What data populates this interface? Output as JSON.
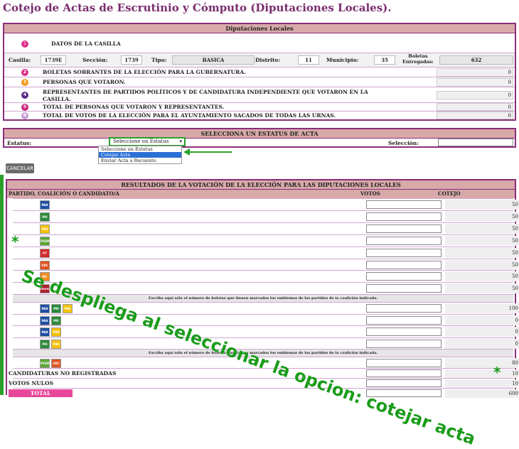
{
  "page_title": "Cotejo de Actas de Escrutinio y Cómputo (Diputaciones Locales).",
  "panel1": {
    "header": "Diputaciones Locales",
    "section_title": "DATOS DE LA CASILLA",
    "fields": {
      "casilla_label": "Casilla:",
      "casilla_value": "1739E",
      "seccion_label": "Sección:",
      "seccion_value": "1739",
      "tipo_label": "Tipo:",
      "tipo_value": "BASICA",
      "distrito_label": "Distrito:",
      "distrito_value": "11",
      "municipio_label": "Municipio:",
      "municipio_value": "35",
      "boletas_label_1": "Boletas",
      "boletas_label_2": "Entregadas:",
      "boletas_value": "632"
    },
    "rows": [
      {
        "label": "BOLETAS SOBRANTES DE LA ELECCIÓN PARA LA GUBERNATURA.",
        "value": "0",
        "color": "#e0308a"
      },
      {
        "label": "PERSONAS QUE VOTARON.",
        "value": "0",
        "color": "#f39a1b"
      },
      {
        "label": "REPRESENTANTES DE PARTIDOS POLÍTICOS Y DE CANDIDATURA INDEPENDIENTE QUE VOTARON EN LA",
        "label2": "CASILLA.",
        "value": "0",
        "color": "#5b2a86"
      },
      {
        "label": "TOTAL DE PERSONAS QUE VOTARON Y REPRESENTANTES.",
        "value": "0",
        "color": "#c8297a"
      },
      {
        "label": "TOTAL DE VOTOS DE LA ELECCIÓN PARA EL AYUNTAMIENTO SACADOS DE TODAS LAS URNAS.",
        "value": "0",
        "color": "#c9a0d8"
      }
    ]
  },
  "panel2": {
    "header": "SELECCIONA UN ESTATUS DE ACTA",
    "estatus_label": "Estatus:",
    "select_value": "Seleccione un Estatus",
    "options": [
      "Seleccione un Estatus",
      "Cotejar Acta",
      "Enviar Acta a Recuento"
    ],
    "seleccion_label": "Selección:"
  },
  "cancel_button": "CANCELAR",
  "results": {
    "header": "RESULTADOS DE LA VOTACIÓN DE LA ELECCIÓN PARA LAS DIPUTACIONES LOCALES",
    "col_party": "PARTIDO, COALICIÓN O CANDIDATO/A",
    "col_votos": "VOTOS",
    "col_cotejo": "COTEJO",
    "party_rows": [
      {
        "logos": [
          "PAN"
        ],
        "cotejo": "50"
      },
      {
        "logos": [
          "PRI"
        ],
        "cotejo": "50"
      },
      {
        "logos": [
          "PRD"
        ],
        "cotejo": "50"
      },
      {
        "logos": [
          "PVEM"
        ],
        "cotejo": "50"
      },
      {
        "logos": [
          "PT"
        ],
        "cotejo": "50"
      },
      {
        "logos": [
          "UDC"
        ],
        "cotejo": "50"
      },
      {
        "logos": [
          "MC"
        ],
        "cotejo": "50"
      },
      {
        "logos": [
          "morena"
        ],
        "cotejo": "50"
      }
    ],
    "coalition_note": "Escriba aquí sólo el número de boletas que tienen marcados los emblemas de los partidos de la coalición indicada.",
    "coalition_rows": [
      {
        "logos": [
          "PAN",
          "PRI",
          "PRD"
        ],
        "cotejo": "100"
      },
      {
        "logos": [
          "PAN",
          "PRI"
        ],
        "cotejo": "0"
      },
      {
        "logos": [
          "PAN",
          "PRD"
        ],
        "cotejo": "0"
      },
      {
        "logos": [
          "PRI",
          "PRD"
        ],
        "cotejo": "0"
      }
    ],
    "coalition2_rows": [
      {
        "logos": [
          "PVEM",
          "UDC"
        ],
        "cotejo": "80"
      }
    ],
    "extra_rows": [
      {
        "label": "CANDIDATURAS NO REGISTRADAS",
        "cotejo": "10"
      },
      {
        "label": "VOTOS NULOS",
        "cotejo": "10"
      },
      {
        "label": "TOTAL",
        "cotejo": "600"
      }
    ]
  },
  "annotation": "Se despliega al seleccionar la opcion: cotejar acta",
  "annotation_star": "*",
  "logo_colors": {
    "PAN": "#1d4fa3",
    "PRI": "#2a8a3a",
    "PRD": "#f5c200",
    "PVEM": "#5aa834",
    "PT": "#d42a2a",
    "UDC": "#e2521e",
    "MC": "#f08a1e",
    "morena": "#b01f2e"
  }
}
